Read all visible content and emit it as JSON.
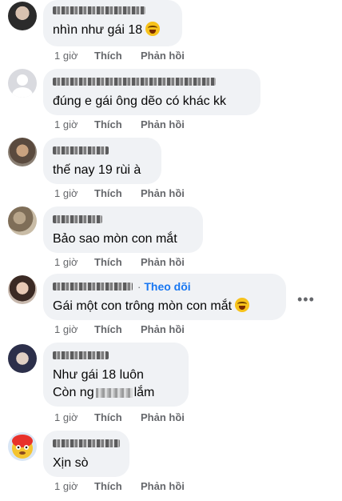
{
  "comments": [
    {
      "text_lines": [
        "nhìn như gái 18"
      ],
      "has_emoji": true,
      "time": "1 giờ"
    },
    {
      "text_lines": [
        "đúng e gái ông dẽo có khác kk"
      ],
      "has_emoji": false,
      "time": "1 giờ"
    },
    {
      "text_lines": [
        "thế nay 19 rùi à"
      ],
      "has_emoji": false,
      "time": "1 giờ"
    },
    {
      "text_lines": [
        "Bảo sao mòn con mắt"
      ],
      "has_emoji": false,
      "time": "1 giờ"
    },
    {
      "text_lines": [
        "Gái một con trông mòn con mắt"
      ],
      "has_emoji": true,
      "time": "1 giờ",
      "follow_label": "Theo dõi"
    },
    {
      "text_lines": [
        "Như gái 18 luôn",
        "Còn ng",
        "lắm"
      ],
      "has_emoji": false,
      "time": "1 giờ"
    },
    {
      "text_lines": [
        "Xịn sò"
      ],
      "has_emoji": false,
      "time": "1 giờ"
    }
  ],
  "actions": {
    "like_label": "Thích",
    "reply_label": "Phản hồi"
  },
  "more_label": "•••",
  "colors": {
    "bubble": "#f0f2f5",
    "link": "#1877f2",
    "meta": "#65676b"
  }
}
